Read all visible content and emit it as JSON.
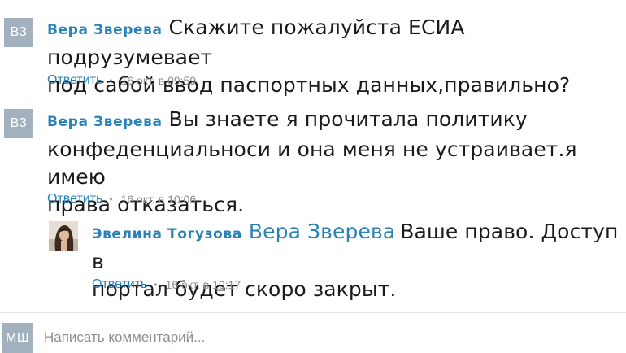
{
  "comments": [
    {
      "avatar_initials": "ВЗ",
      "author": "Вера Зверева",
      "text_lines": [
        "Скажите пожалуйста ЕСИА подрузумевает",
        "под сабой ввод паспортных данных,правильно?"
      ],
      "reply_label": "Ответить",
      "time": "16 окт. в 09:59"
    },
    {
      "avatar_initials": "ВЗ",
      "author": "Вера Зверева",
      "text_lines": [
        "Вы знаете я прочитала политику",
        "конфеденциальноси и она меня не устраивает.я имею",
        "права отказаться."
      ],
      "reply_label": "Ответить",
      "time": "16 окт. в 10:06"
    },
    {
      "avatar_icon": "user-photo",
      "author": "Эвелина Тогузова",
      "mention": "Вера Зверева",
      "text_lines": [
        "Ваше право. Доступ в",
        "портал будет скоро закрыт."
      ],
      "reply_label": "Ответить",
      "time": "16 окт. в 10:17"
    }
  ],
  "compose": {
    "avatar_initials": "МШ",
    "placeholder": "Написать комментарий..."
  },
  "colors": {
    "accent": "#2a83b8",
    "avatar_bg": "#a3b1bf",
    "meta": "#8c8c8c"
  }
}
